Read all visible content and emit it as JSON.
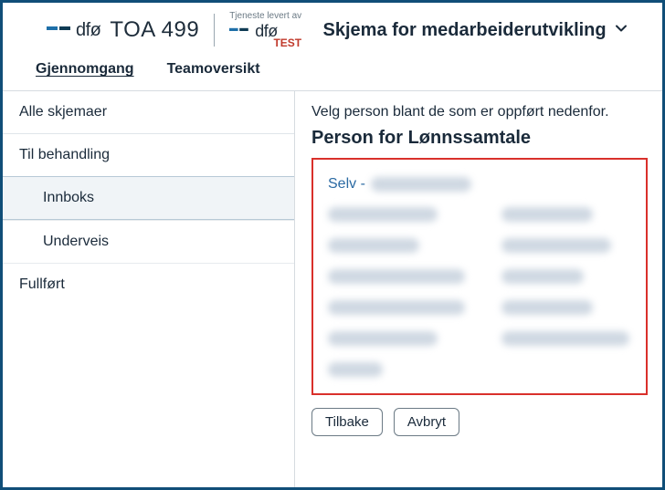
{
  "brand": {
    "word": "dfø",
    "sub": "TOA 499",
    "tj_caption": "Tjeneste levert av",
    "tj_word": "dfø",
    "tj_test": "TEST"
  },
  "header": {
    "title": "Skjema for medarbeiderutvikling"
  },
  "tabs": {
    "gjennomgang": "Gjennomgang",
    "teamoversikt": "Teamoversikt"
  },
  "sidebar": {
    "alle": "Alle skjemaer",
    "til_behandling": "Til behandling",
    "innboks": "Innboks",
    "underveis": "Underveis",
    "fullfort": "Fullført"
  },
  "main": {
    "hint": "Velg person blant de som er oppført nedenfor.",
    "title": "Person for Lønnssamtale",
    "self_prefix": "Selv - "
  },
  "actions": {
    "tilbake": "Tilbake",
    "avbryt": "Avbryt"
  }
}
